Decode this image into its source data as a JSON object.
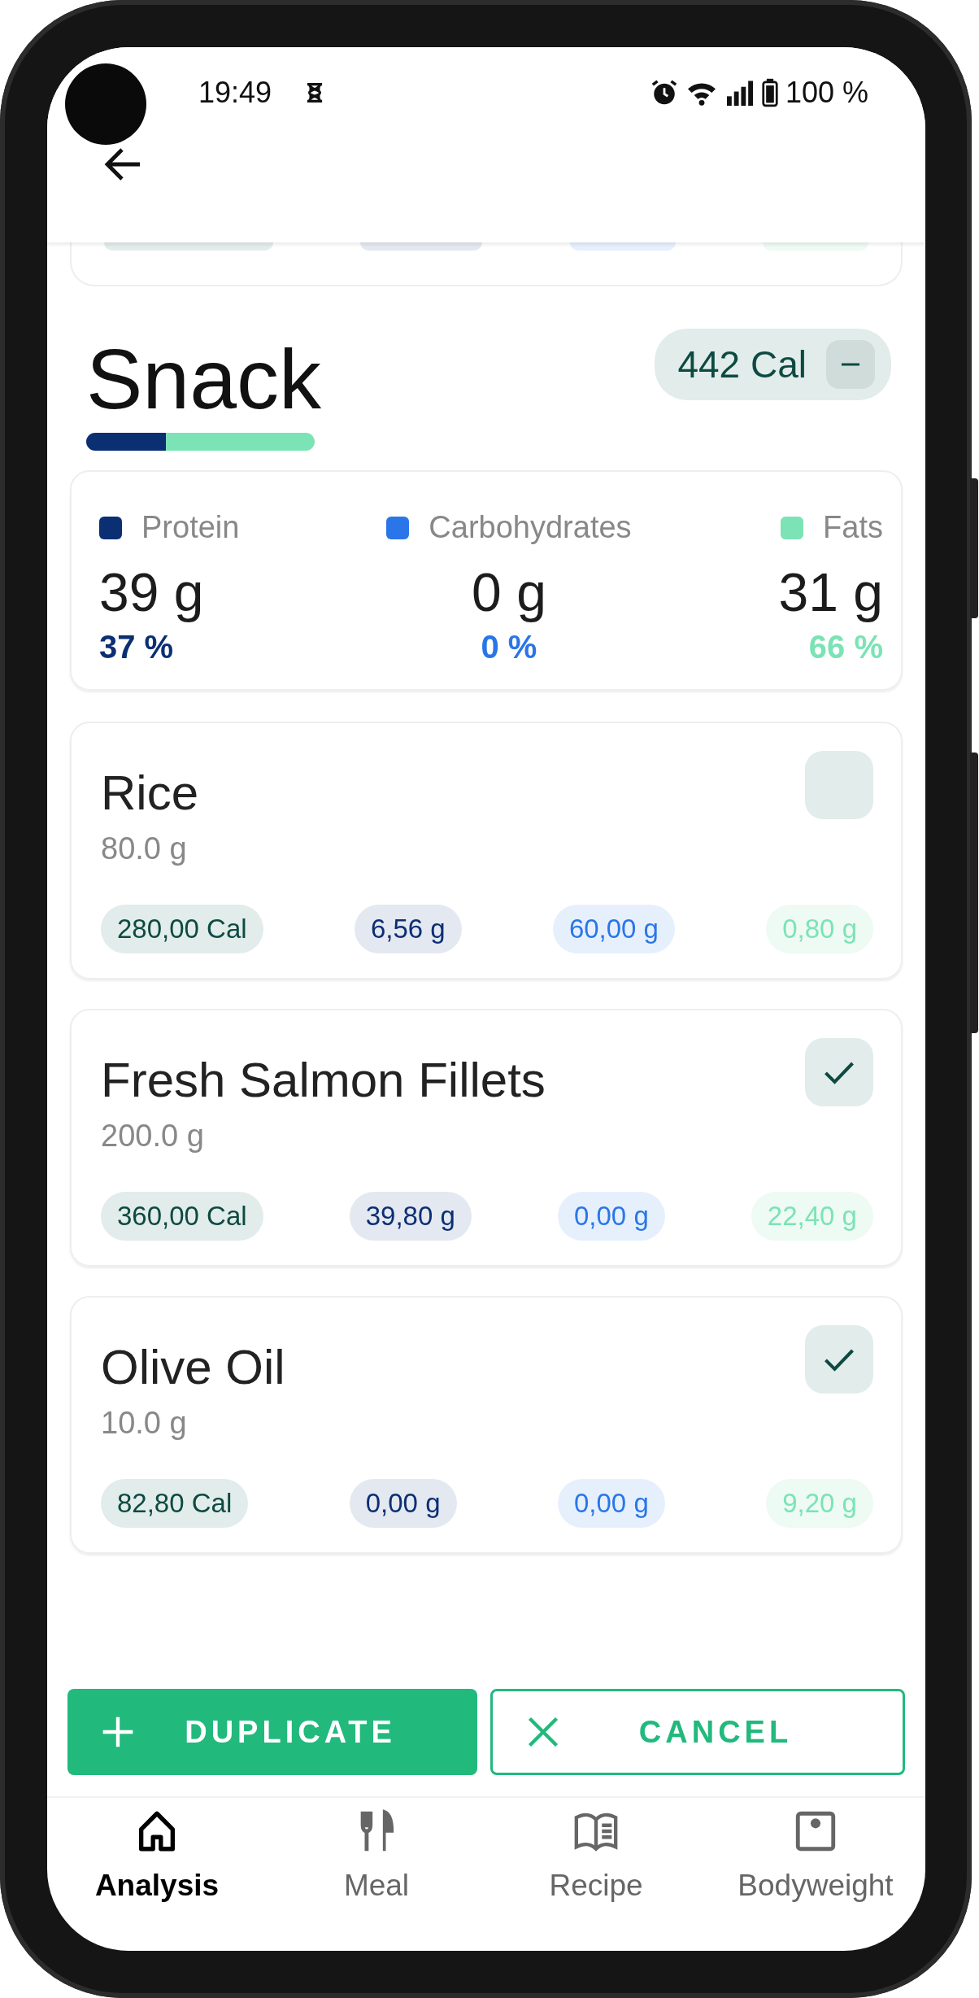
{
  "status_bar": {
    "time": "19:49",
    "battery": "100 %"
  },
  "meal": {
    "title": "Snack",
    "calories": "442 Cal",
    "bar": [
      {
        "level": 0.35,
        "color": "#0b2f73"
      },
      {
        "level": 0.65,
        "color": "#7be3b5"
      }
    ]
  },
  "macros": [
    {
      "label": "Protein",
      "amount": "39 g",
      "percent": "37 %",
      "color": "#0b2f73"
    },
    {
      "label": "Carbohydrates",
      "amount": "0 g",
      "percent": "0 %",
      "color": "#2a76e8"
    },
    {
      "label": "Fats",
      "amount": "31 g",
      "percent": "66 %",
      "color": "#7be3b5"
    }
  ],
  "items": [
    {
      "name": "Rice",
      "weight": "80.0 g",
      "checked": false,
      "values": [
        "280,00 Cal",
        "6,56 g",
        "60,00 g",
        "0,80 g"
      ]
    },
    {
      "name": "Fresh Salmon Fillets",
      "weight": "200.0 g",
      "checked": true,
      "values": [
        "360,00 Cal",
        "39,80 g",
        "0,00 g",
        "22,40 g"
      ]
    },
    {
      "name": "Olive Oil",
      "weight": "10.0 g",
      "checked": true,
      "values": [
        "82,80 Cal",
        "0,00 g",
        "0,00 g",
        "9,20 g"
      ]
    }
  ],
  "actions": [
    {
      "label": "DUPLICATE",
      "kind": "primary"
    },
    {
      "label": "CANCEL",
      "kind": "outline"
    }
  ],
  "nav": [
    {
      "label": "Analysis",
      "kind": "home",
      "selected": true
    },
    {
      "label": "Meal",
      "kind": "cutlery",
      "selected": false
    },
    {
      "label": "Recipe",
      "kind": "book",
      "selected": false
    },
    {
      "label": "Bodyweight",
      "kind": "scale",
      "selected": false
    }
  ]
}
